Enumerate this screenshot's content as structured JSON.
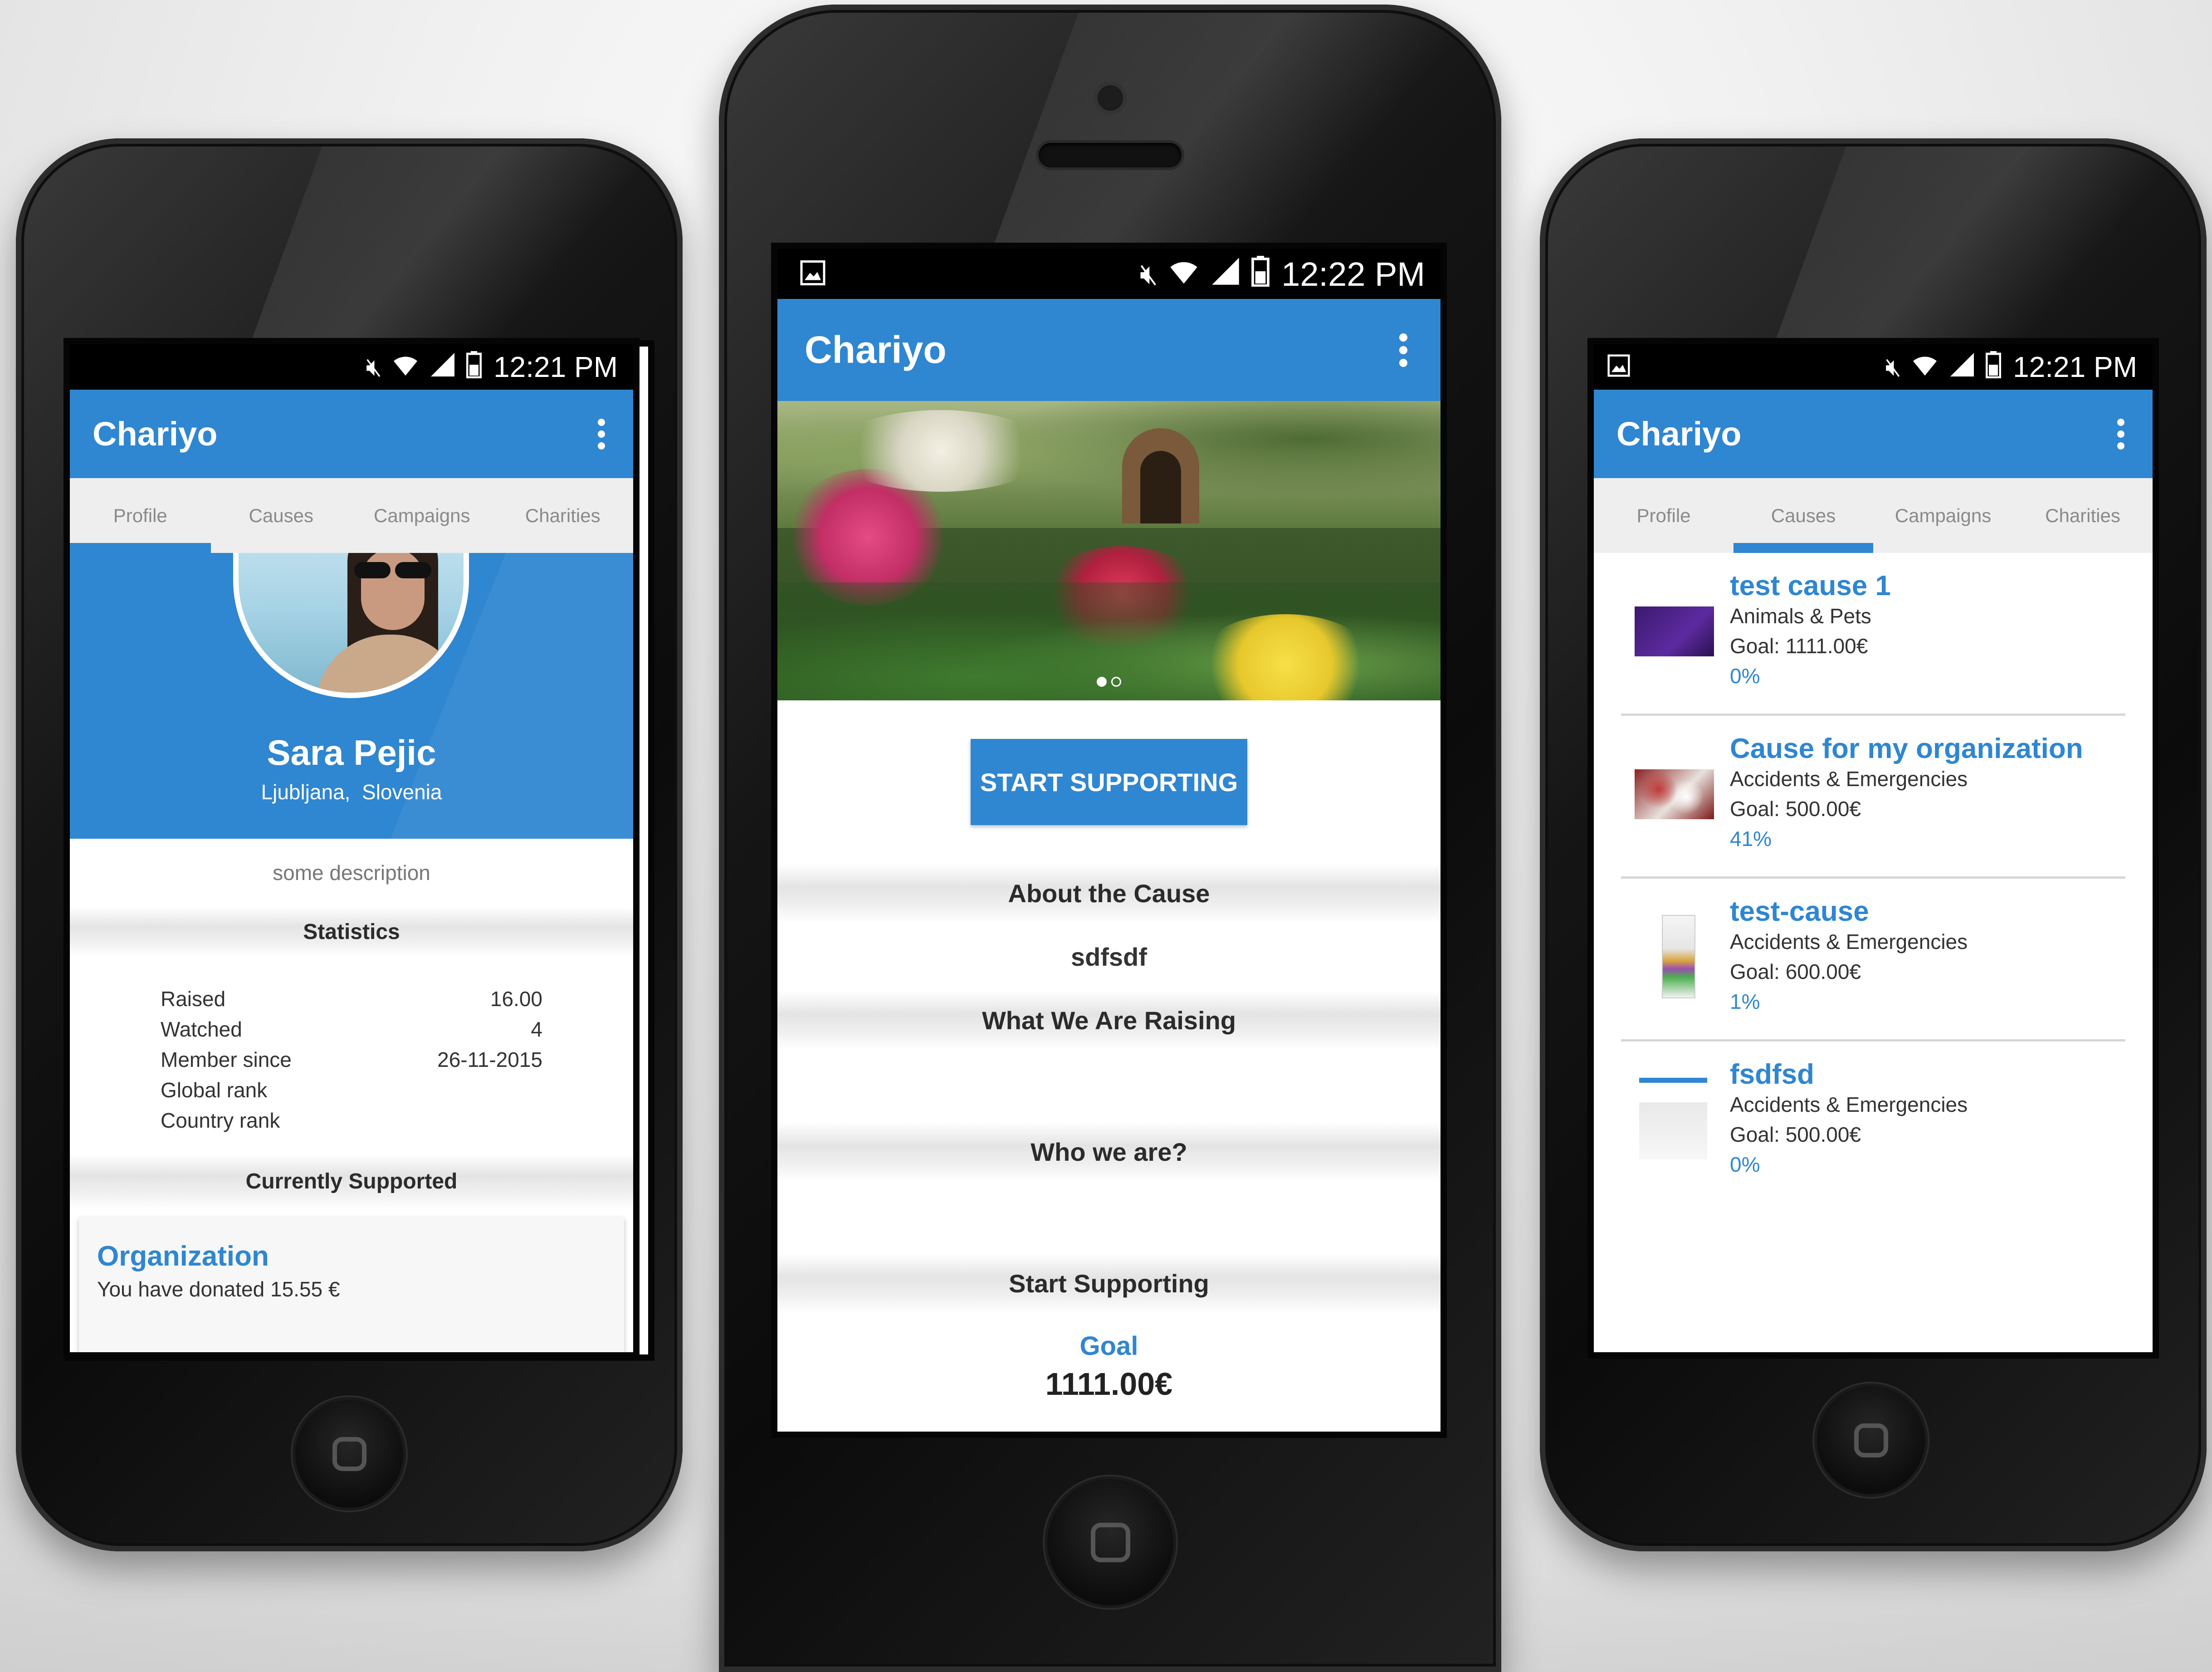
{
  "app": {
    "title": "Chariyo"
  },
  "left": {
    "status_time": "12:21 PM",
    "tabs": [
      "Profile",
      "Causes",
      "Campaigns",
      "Charities"
    ],
    "profile": {
      "name": "Sara Pejic",
      "city": "Ljubljana,",
      "country": "Slovenia",
      "description": "some description"
    },
    "statistics": {
      "title": "Statistics",
      "rows": [
        {
          "label": "Raised",
          "value": "16.00"
        },
        {
          "label": "Watched",
          "value": "4"
        },
        {
          "label": "Member since",
          "value": "26-11-2015"
        },
        {
          "label": "Global rank",
          "value": ""
        },
        {
          "label": "Country rank",
          "value": ""
        }
      ]
    },
    "currently_supported": {
      "title": "Currently Supported",
      "org_name": "Organization",
      "donated": "You have donated 15.55 €"
    }
  },
  "center": {
    "status_time": "12:22 PM",
    "cta": "START SUPPORTING",
    "sections": {
      "about": "About the Cause",
      "about_text": "sdfsdf",
      "raising": "What We Are Raising",
      "who": "Who we are?",
      "start": "Start Supporting"
    },
    "goal_label": "Goal",
    "goal_value": "1111.00€",
    "carousel_slides": 2,
    "carousel_active": 1
  },
  "right": {
    "status_time": "12:21 PM",
    "tabs": [
      "Profile",
      "Causes",
      "Campaigns",
      "Charities"
    ],
    "causes": [
      {
        "title": "test cause 1",
        "category": "Animals & Pets",
        "goal": "Goal: 1111.00€",
        "percent": "0%"
      },
      {
        "title": "Cause for my organization",
        "category": "Accidents & Emergencies",
        "goal": "Goal: 500.00€",
        "percent": "41%"
      },
      {
        "title": "test-cause",
        "category": "Accidents & Emergencies",
        "goal": "Goal: 600.00€",
        "percent": "1%"
      },
      {
        "title": "fsdfsd",
        "category": "Accidents & Emergencies",
        "goal": "Goal: 500.00€",
        "percent": "0%"
      }
    ]
  },
  "colors": {
    "primary": "#2f86d1",
    "link": "#2a83c9",
    "statusbar": "#000000"
  },
  "icons": [
    "mute-icon",
    "wifi-icon",
    "signal-icon",
    "battery-icon",
    "image-notification-icon",
    "overflow-menu-icon"
  ]
}
